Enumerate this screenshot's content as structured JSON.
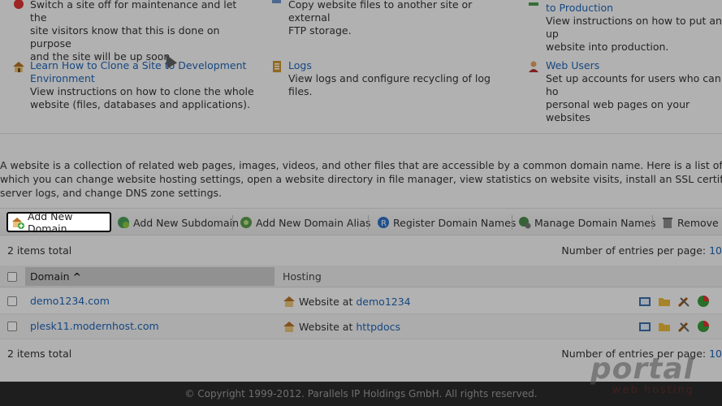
{
  "tasks": [
    {
      "icon": "power-icon",
      "title": "",
      "desc_lines": [
        "Switch a site off for maintenance and let the",
        "site visitors know that this is done on purpose",
        "and the site will be up soon."
      ]
    },
    {
      "icon": "copy-icon",
      "title": "",
      "desc_lines": [
        "Copy website files to another site or external",
        "FTP storage."
      ]
    },
    {
      "icon": "production-icon",
      "title": "to Production",
      "desc_lines": [
        "View instructions on how to put an up",
        "website into production."
      ]
    },
    {
      "icon": "house-icon",
      "title_lines": [
        "Learn How to Clone a Site to Development",
        "Environment"
      ],
      "desc_lines": [
        "View instructions on how to clone the whole",
        "website (files, databases and applications)."
      ]
    },
    {
      "icon": "logs-icon",
      "title": "Logs",
      "desc_lines": [
        "View logs and configure recycling of log files."
      ]
    },
    {
      "icon": "web-users-icon",
      "title": "Web Users",
      "desc_lines": [
        "Set up accounts for users who can ho",
        "personal web pages on your websites"
      ]
    }
  ],
  "intro_lines": [
    "A website is a collection of related web pages, images, videos, and other files that are accessible by a common domain name. Here is a list of your web",
    "which you can change website hosting settings, open a website directory in file manager, view statistics on website visits, install an SSL certificate, vi",
    "server logs, and change DNS zone settings."
  ],
  "toolbar": {
    "add_domain": "Add New Domain",
    "add_subdomain": "Add New Subdomain",
    "add_alias": "Add New Domain Alias",
    "register": "Register Domain Names",
    "manage": "Manage Domain Names",
    "remove": "Remove"
  },
  "list": {
    "total": "2 items total",
    "per_page_label": "Number of entries per page:",
    "per_page_value": "10",
    "columns": {
      "domain": "Domain",
      "sort_arrow": "^",
      "hosting": "Hosting"
    },
    "rows": [
      {
        "domain": "demo1234.com",
        "hosting_prefix": "Website at",
        "hosting_link": "demo1234"
      },
      {
        "domain": "plesk11.modernhost.com",
        "hosting_prefix": "Website at",
        "hosting_link": "httpdocs"
      }
    ]
  },
  "footer": "© Copyright 1999-2012. Parallels IP Holdings GmbH. All rights reserved.",
  "watermark": {
    "big": "portal",
    "small": "web hosting"
  }
}
